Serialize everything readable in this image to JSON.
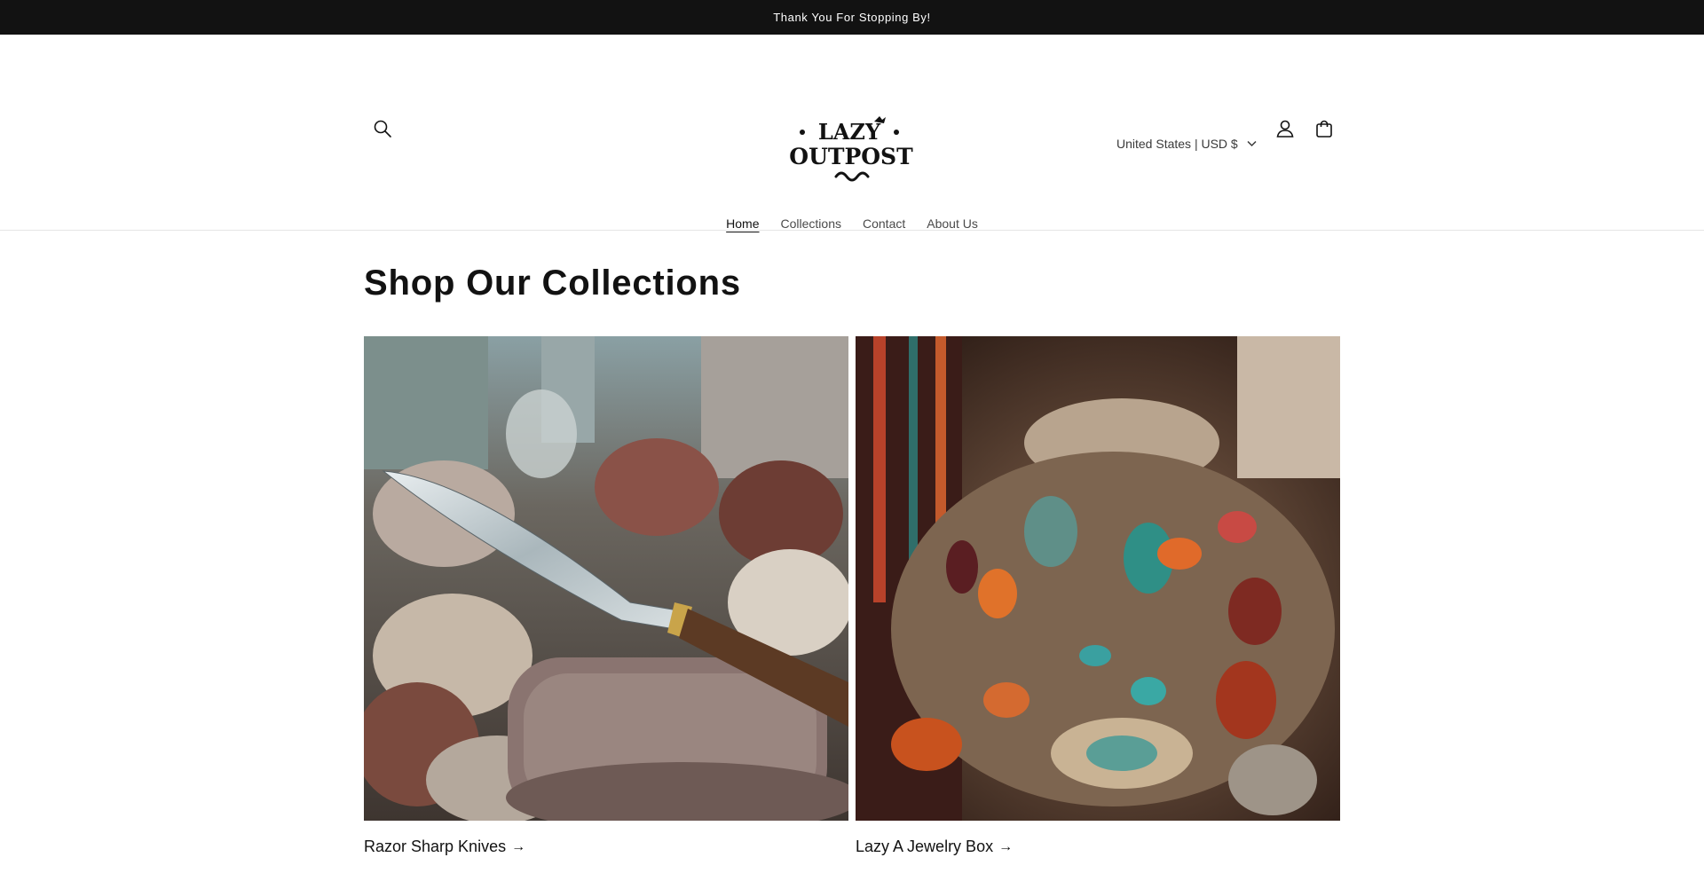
{
  "announcement": {
    "text": "Thank You For Stopping By!"
  },
  "header": {
    "logo": {
      "line1": "LAZY",
      "line2": "OUTPOST"
    },
    "country_selector": "United States | USD $",
    "icons": {
      "search": "search-icon",
      "account": "account-icon",
      "cart": "cart-icon",
      "chevron": "chevron-down-icon"
    }
  },
  "nav": {
    "items": [
      {
        "label": "Home",
        "active": true
      },
      {
        "label": "Collections",
        "active": false
      },
      {
        "label": "Contact",
        "active": false
      },
      {
        "label": "About Us",
        "active": false
      }
    ]
  },
  "main": {
    "section_title": "Shop Our Collections",
    "collections": [
      {
        "label": "Razor Sharp Knives",
        "arrow": "→"
      },
      {
        "label": "Lazy A Jewelry Box",
        "arrow": "→"
      }
    ]
  },
  "colors": {
    "announcement_bg": "#121212",
    "text": "#121212",
    "background": "#ffffff"
  }
}
